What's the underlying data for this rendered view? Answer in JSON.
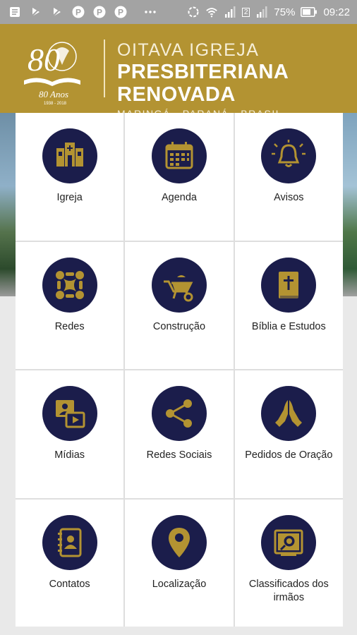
{
  "status_bar": {
    "battery": "75%",
    "time": "09:22",
    "sim_badge": "2",
    "icons": [
      "notification-icon",
      "mute-icon",
      "mute-icon",
      "pinterest-icon",
      "pinterest-icon",
      "pinterest-icon",
      "more-icon",
      "sync-icon",
      "wifi-icon",
      "signal-icon",
      "signal-icon",
      "battery-icon"
    ]
  },
  "header": {
    "logo_number": "80",
    "logo_text": "80 Anos",
    "logo_years": "1938 - 2018",
    "line1": "OITAVA IGREJA",
    "line2": "PRESBITERIANA RENOVADA",
    "line3": "MARINGÁ - PARANÁ - BRASIL"
  },
  "colors": {
    "gold": "#b39332",
    "navy": "#1b1d4b",
    "icon_gold": "#b39332"
  },
  "menu": [
    {
      "label": "Igreja",
      "icon": "church-icon"
    },
    {
      "label": "Agenda",
      "icon": "calendar-icon"
    },
    {
      "label": "Avisos",
      "icon": "bell-icon"
    },
    {
      "label": "Redes",
      "icon": "network-icon"
    },
    {
      "label": "Construção",
      "icon": "wheelbarrow-icon"
    },
    {
      "label": "Bíblia e Estudos",
      "icon": "bible-icon"
    },
    {
      "label": "Mídias",
      "icon": "media-icon"
    },
    {
      "label": "Redes Sociais",
      "icon": "share-icon"
    },
    {
      "label": "Pedidos de Oração",
      "icon": "praying-hands-icon"
    },
    {
      "label": "Contatos",
      "icon": "contacts-icon"
    },
    {
      "label": "Localização",
      "icon": "location-pin-icon"
    },
    {
      "label": "Classificados dos irmãos",
      "icon": "classifieds-icon"
    }
  ]
}
